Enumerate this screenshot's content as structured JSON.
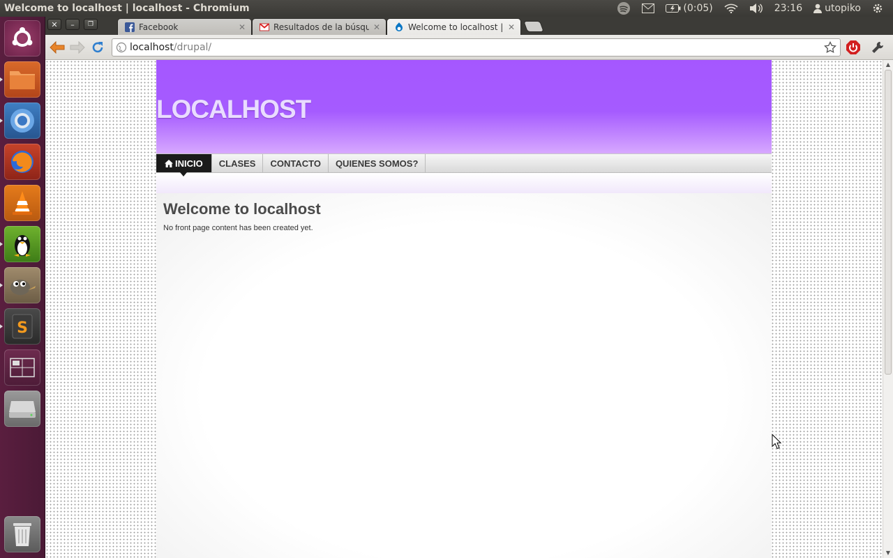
{
  "top_panel": {
    "window_title": "Welcome to localhost | localhost - Chromium",
    "battery": "(0:05)",
    "clock": "23:16",
    "user": "utopiko"
  },
  "launcher": {
    "items": [
      "ubuntu-dash-icon",
      "files-icon",
      "chromium-icon",
      "firefox-icon",
      "vlc-icon",
      "linux-tux-icon",
      "gimp-icon",
      "sublime-text-icon",
      "workspace-switcher-icon",
      "disk-drive-icon",
      "trash-icon"
    ]
  },
  "tabs": [
    {
      "title": "Facebook",
      "active": false
    },
    {
      "title": "Resultados de la búsqueda",
      "active": false
    },
    {
      "title": "Welcome to localhost | loc",
      "active": true
    }
  ],
  "omnibox": {
    "host": "localhost",
    "path": "/drupal/"
  },
  "site": {
    "name": "LOCALHOST",
    "nav": [
      {
        "label": "INICIO",
        "active": true
      },
      {
        "label": "CLASES",
        "active": false
      },
      {
        "label": "CONTACTO",
        "active": false
      },
      {
        "label": "QUIENES SOMOS?",
        "active": false
      }
    ],
    "page_title": "Welcome to localhost",
    "message": "No front page content has been created yet."
  },
  "colors": {
    "header_purple": "#a557ff",
    "launcher": "#5a1e3f",
    "nav_active": "#1b1b1b"
  }
}
